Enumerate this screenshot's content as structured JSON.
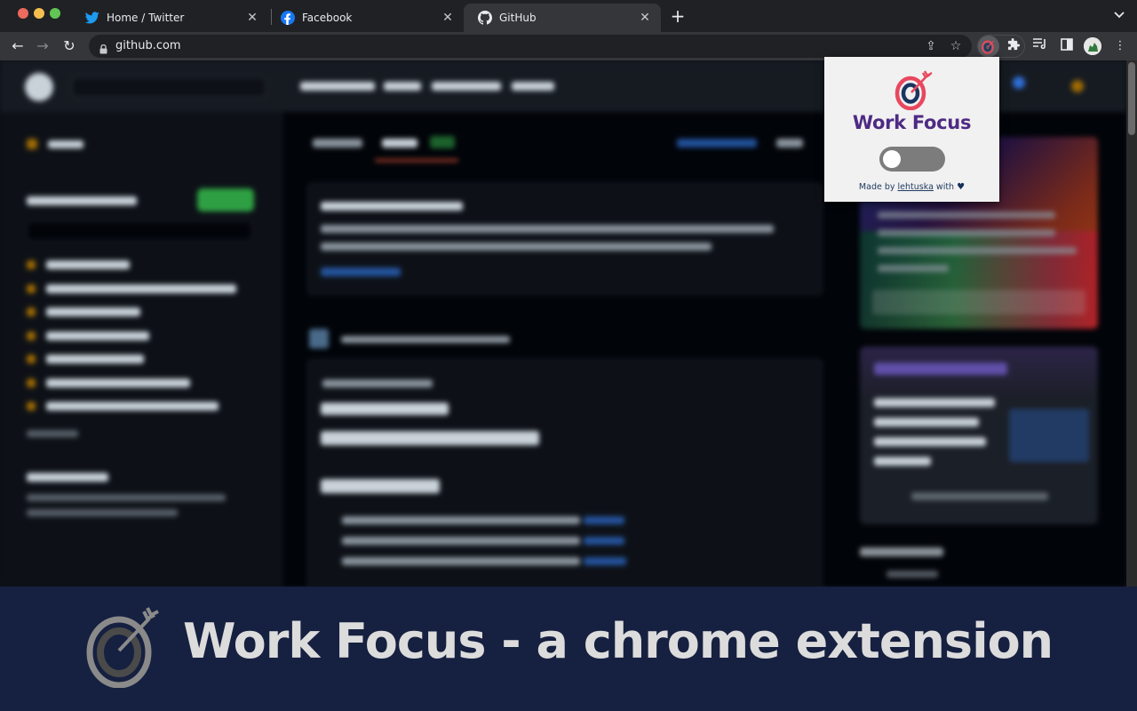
{
  "browser": {
    "tabs": [
      {
        "title": "Home / Twitter",
        "favicon": "twitter-icon",
        "active": false
      },
      {
        "title": "Facebook",
        "favicon": "facebook-icon",
        "active": false
      },
      {
        "title": "GitHub",
        "favicon": "github-icon",
        "active": true
      }
    ],
    "close_glyph": "✕",
    "new_tab_glyph": "+",
    "tab_menu_glyph": "⌄",
    "address_bar": {
      "url": "github.com",
      "secure": true
    },
    "nav": {
      "back": "←",
      "forward": "→",
      "reload": "↻"
    },
    "toolbar_icons": {
      "share": "⇪",
      "bookmark": "☆",
      "extensions": "🧩",
      "media": "≡",
      "side_panel": "▮",
      "menu": "⋮"
    }
  },
  "extension_popup": {
    "title": "Work Focus",
    "toggle": {
      "enabled": false
    },
    "credit": {
      "prefix": "Made by",
      "author": "lehtuska",
      "suffix": "with",
      "heart": "♥"
    },
    "colors": {
      "title": "#4e2a84",
      "ring_outer": "#e8485d",
      "ring_inner": "#1b3561",
      "toggle_off": "#7c7c7c"
    }
  },
  "banner": {
    "title": "Work Focus - a chrome extension",
    "colors": {
      "background": "#162040",
      "text": "#dcdcdc"
    }
  }
}
